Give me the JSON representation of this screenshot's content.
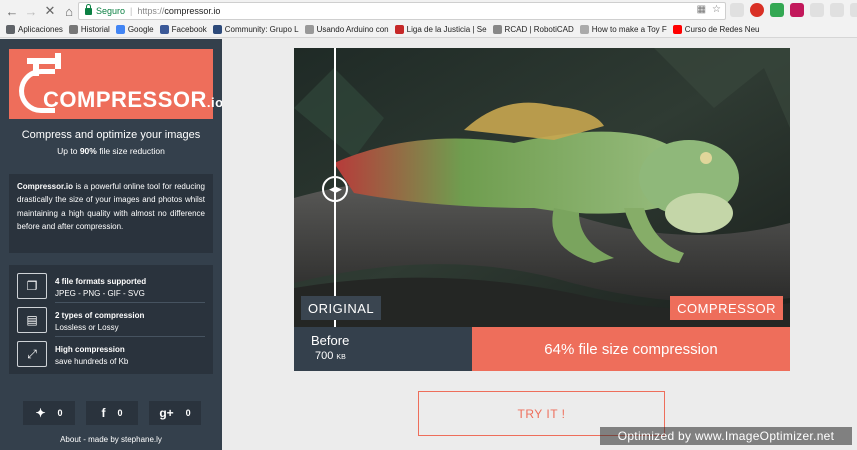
{
  "browser": {
    "secure_label": "Seguro",
    "url_scheme": "https://",
    "url_host": "compressor.io",
    "bookmarks": [
      {
        "label": "Aplicaciones",
        "color": "#5f6368"
      },
      {
        "label": "Historial",
        "color": "#777777"
      },
      {
        "label": "Google",
        "color": "#4285f4"
      },
      {
        "label": "Facebook",
        "color": "#3b5998"
      },
      {
        "label": "Community: Grupo L",
        "color": "#2d4a7a"
      },
      {
        "label": "Usando Arduino con",
        "color": "#999999"
      },
      {
        "label": "Liga de la Justicia | Se",
        "color": "#c62828"
      },
      {
        "label": "RCAD | RobotiCAD",
        "color": "#888888"
      },
      {
        "label": "How to make a Toy F",
        "color": "#aaaaaa"
      },
      {
        "label": "Curso de Redes Neu",
        "color": "#ff0000"
      }
    ]
  },
  "sidebar": {
    "logo_text": "COMPRESSOR",
    "logo_suffix": ".io",
    "tagline": "Compress and optimize your images",
    "subtag_prefix": "Up to ",
    "subtag_bold": "90%",
    "subtag_suffix": " file size reduction",
    "description_bold": "Compressor.io",
    "description_rest": " is a powerful online tool for reducing drastically the size of your images and photos whilst maintaining a high quality with almost no difference before and after compression.",
    "features": [
      {
        "title": "4 file formats supported",
        "subtitle": "JPEG - PNG - GIF - SVG",
        "icon": "files-icon"
      },
      {
        "title": "2 types of compression",
        "subtitle": "Lossless or Lossy",
        "icon": "image-icon"
      },
      {
        "title": "High compression",
        "subtitle": "save hundreds of Kb",
        "icon": "compress-arrows-icon"
      }
    ],
    "social": [
      {
        "network": "twitter",
        "glyph": "🐦",
        "count": "0"
      },
      {
        "network": "facebook",
        "glyph": "f",
        "count": "0"
      },
      {
        "network": "google-plus",
        "glyph": "g+",
        "count": "0"
      }
    ],
    "footer": "About - made by stephane.ly"
  },
  "main": {
    "label_original": "ORIGINAL",
    "label_compressor": "COMPRESSOR",
    "before_title": "Before",
    "before_size": "700",
    "before_unit": "KB",
    "result_text": "64% file size compression",
    "try_button": "TRY IT !"
  },
  "watermark": "Optimized by www.ImageOptimizer.net",
  "colors": {
    "accent": "#ee6e5b",
    "sidebar_bg": "#34404c",
    "panel_bg": "#2a333d"
  }
}
